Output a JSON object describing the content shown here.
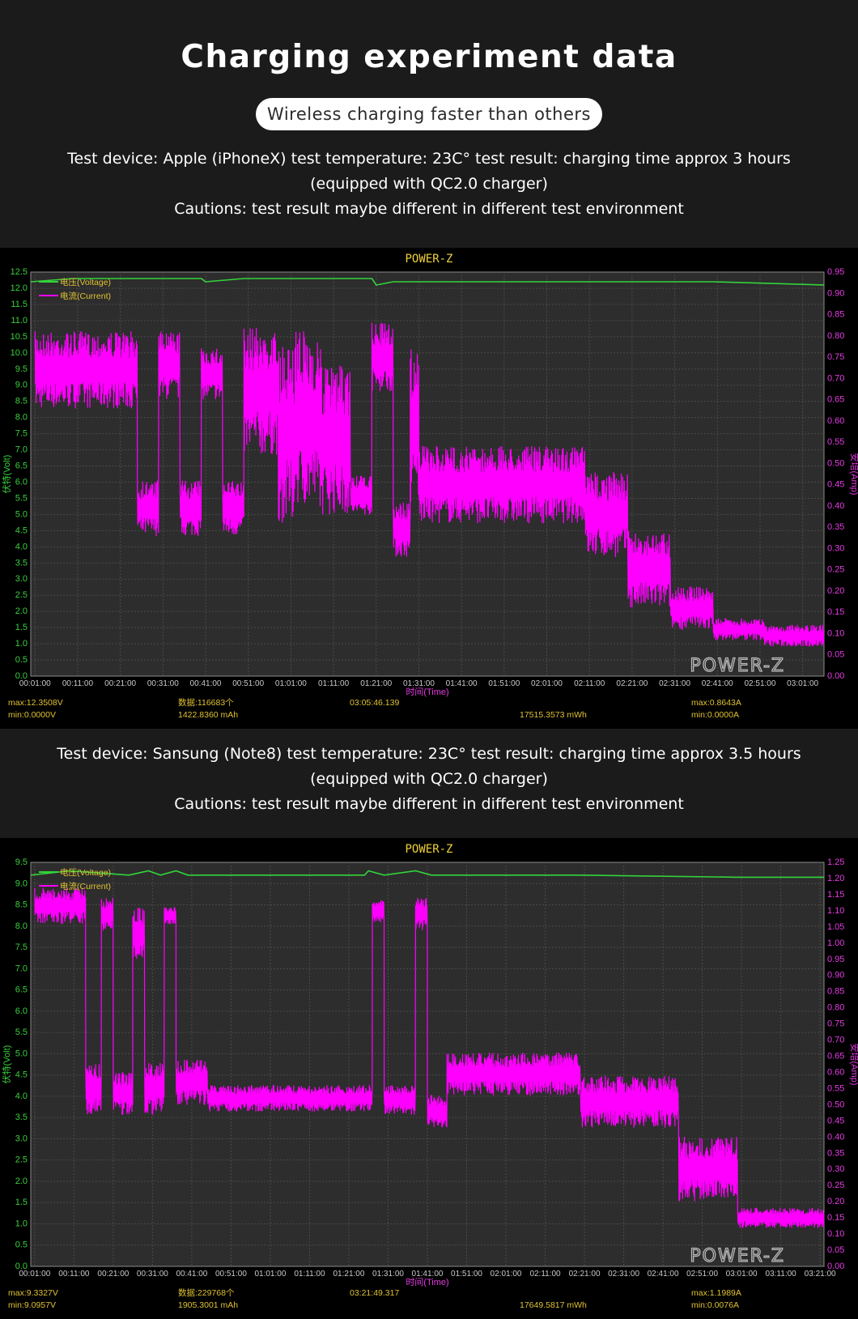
{
  "header": {
    "title": "Charging experiment data",
    "pill": "Wireless charging faster than others",
    "info1": {
      "line1": "Test device: Apple (iPhoneX)  test temperature: 23C° test result: charging time approx 3 hours",
      "line2": "(equipped with QC2.0 charger)",
      "line3": "Cautions: test result maybe different in different test environment"
    },
    "info2": {
      "line1": "Test device: Sansung (Note8)  test temperature: 23C° test result: charging time approx 3.5 hours",
      "line2": "(equipped with QC2.0 charger)",
      "line3": "Cautions: test result maybe different in different test environment"
    }
  },
  "colors": {
    "voltage": "#33d43a",
    "current": "#ff00ff",
    "grid": "#4a4a4a",
    "plot_bg": "#2d2d2d",
    "brand": "#f0d23a"
  },
  "chart_data": [
    {
      "type": "line",
      "title": "POWER-Z",
      "watermark": "POWER-Z",
      "xlabel": "时间(Time)",
      "ylabel_left": "伏特(Volt)",
      "ylabel_right": "安培(Amp)",
      "ylim_left": [
        0,
        12.5
      ],
      "ylim_right": [
        0,
        0.95
      ],
      "left_ticks": [
        "0.0",
        "0.5",
        "1.0",
        "1.5",
        "2.0",
        "2.5",
        "3.0",
        "3.5",
        "4.0",
        "4.5",
        "5.0",
        "5.5",
        "6.0",
        "6.5",
        "7.0",
        "7.5",
        "8.0",
        "8.5",
        "9.0",
        "9.5",
        "10.0",
        "10.5",
        "11.0",
        "11.5",
        "12.0",
        "12.5"
      ],
      "right_ticks": [
        "0.00",
        "0.05",
        "0.10",
        "0.15",
        "0.20",
        "0.25",
        "0.30",
        "0.35",
        "0.40",
        "0.45",
        "0.50",
        "0.55",
        "0.60",
        "0.65",
        "0.70",
        "0.75",
        "0.80",
        "0.85",
        "0.90",
        "0.95"
      ],
      "x_ticks": [
        "00:01:00",
        "00:11:00",
        "00:21:00",
        "00:31:00",
        "00:41:00",
        "00:51:00",
        "01:01:00",
        "01:11:00",
        "01:21:00",
        "01:31:00",
        "01:41:00",
        "01:51:00",
        "02:01:00",
        "02:11:00",
        "02:21:00",
        "02:31:00",
        "02:41:00",
        "02:51:00",
        "03:01:00"
      ],
      "x_minutes_range": [
        0,
        186
      ],
      "legend": [
        "电压(Voltage)",
        "电流(Current)"
      ],
      "series": [
        {
          "name": "电压(Voltage)",
          "axis": "left",
          "color": "#33d43a",
          "points": [
            [
              0,
              12.2
            ],
            [
              10,
              12.3
            ],
            [
              40,
              12.3
            ],
            [
              41,
              12.2
            ],
            [
              50,
              12.3
            ],
            [
              80,
              12.3
            ],
            [
              81,
              12.1
            ],
            [
              85,
              12.2
            ],
            [
              120,
              12.2
            ],
            [
              160,
              12.2
            ],
            [
              186,
              12.1
            ]
          ]
        },
        {
          "name": "电流(Current)",
          "axis": "right",
          "color": "#ff00ff",
          "blocks": [
            [
              1,
              25,
              0.63,
              0.81
            ],
            [
              25,
              30,
              0.33,
              0.46
            ],
            [
              30,
              35,
              0.65,
              0.81
            ],
            [
              35,
              40,
              0.33,
              0.46
            ],
            [
              40,
              45,
              0.65,
              0.77
            ],
            [
              45,
              50,
              0.33,
              0.46
            ],
            [
              50,
              58,
              0.52,
              0.82
            ],
            [
              58,
              62,
              0.36,
              0.79
            ],
            [
              62,
              68,
              0.4,
              0.81
            ],
            [
              68,
              75,
              0.38,
              0.73
            ],
            [
              75,
              80,
              0.38,
              0.47
            ],
            [
              80,
              85,
              0.67,
              0.83
            ],
            [
              85,
              89,
              0.28,
              0.41
            ],
            [
              89,
              91,
              0.4,
              0.78
            ],
            [
              91,
              130,
              0.36,
              0.54
            ],
            [
              130,
              140,
              0.28,
              0.48
            ],
            [
              140,
              150,
              0.16,
              0.34
            ],
            [
              150,
              160,
              0.11,
              0.21
            ],
            [
              160,
              172,
              0.085,
              0.135
            ],
            [
              172,
              186,
              0.07,
              0.12
            ]
          ]
        }
      ],
      "stats": {
        "max_v": "max:12.3508V",
        "min_v": "min:0.0000V",
        "count": "数据:116683个",
        "capacity": "1422.8360 mAh",
        "duration": "03:05:46.139",
        "energy": "17515.3573 mWh",
        "max_a": "max:0.8643A",
        "min_a": "min:0.0000A"
      }
    },
    {
      "type": "line",
      "title": "POWER-Z",
      "watermark": "POWER-Z",
      "xlabel": "时间(Time)",
      "ylabel_left": "伏特(Volt)",
      "ylabel_right": "安培(Amp)",
      "ylim_left": [
        0,
        9.5
      ],
      "ylim_right": [
        0,
        1.25
      ],
      "left_ticks": [
        "0.0",
        "0.5",
        "1.0",
        "1.5",
        "2.0",
        "2.5",
        "3.0",
        "3.5",
        "4.0",
        "4.5",
        "5.0",
        "5.5",
        "6.0",
        "6.5",
        "7.0",
        "7.5",
        "8.0",
        "8.5",
        "9.0",
        "9.5"
      ],
      "right_ticks": [
        "0.00",
        "0.05",
        "0.10",
        "0.15",
        "0.20",
        "0.25",
        "0.30",
        "0.35",
        "0.40",
        "0.45",
        "0.50",
        "0.55",
        "0.60",
        "0.65",
        "0.70",
        "0.75",
        "0.80",
        "0.85",
        "0.90",
        "0.95",
        "1.00",
        "1.05",
        "1.10",
        "1.15",
        "1.20",
        "1.25"
      ],
      "x_ticks": [
        "00:01:00",
        "00:11:00",
        "00:21:00",
        "00:31:00",
        "00:41:00",
        "00:51:00",
        "01:01:00",
        "01:11:00",
        "01:21:00",
        "01:31:00",
        "01:41:00",
        "01:51:00",
        "02:01:00",
        "02:11:00",
        "02:21:00",
        "02:31:00",
        "02:41:00",
        "02:51:00",
        "03:01:00",
        "03:11:00",
        "03:21:00"
      ],
      "x_minutes_range": [
        0,
        202
      ],
      "legend": [
        "电压(Voltage)",
        "电流(Current)"
      ],
      "series": [
        {
          "name": "电压(Voltage)",
          "axis": "left",
          "color": "#33d43a",
          "points": [
            [
              0,
              9.2
            ],
            [
              10,
              9.3
            ],
            [
              25,
              9.2
            ],
            [
              30,
              9.3
            ],
            [
              33,
              9.2
            ],
            [
              37,
              9.3
            ],
            [
              40,
              9.2
            ],
            [
              85,
              9.2
            ],
            [
              86,
              9.3
            ],
            [
              90,
              9.2
            ],
            [
              98,
              9.3
            ],
            [
              102,
              9.2
            ],
            [
              140,
              9.2
            ],
            [
              180,
              9.15
            ],
            [
              202,
              9.15
            ]
          ]
        },
        {
          "name": "电流(Current)",
          "axis": "right",
          "color": "#ff00ff",
          "blocks": [
            [
              1,
              14,
              1.06,
              1.17
            ],
            [
              14,
              18,
              0.47,
              0.63
            ],
            [
              18,
              21,
              1.04,
              1.14
            ],
            [
              21,
              26,
              0.47,
              0.6
            ],
            [
              26,
              29,
              0.95,
              1.11
            ],
            [
              29,
              34,
              0.47,
              0.63
            ],
            [
              34,
              37,
              1.06,
              1.11
            ],
            [
              37,
              45,
              0.5,
              0.64
            ],
            [
              45,
              87,
              0.48,
              0.56
            ],
            [
              87,
              90,
              1.06,
              1.14
            ],
            [
              90,
              98,
              0.47,
              0.56
            ],
            [
              98,
              101,
              1.04,
              1.14
            ],
            [
              101,
              106,
              0.43,
              0.53
            ],
            [
              106,
              140,
              0.53,
              0.66
            ],
            [
              140,
              165,
              0.43,
              0.59
            ],
            [
              165,
              180,
              0.2,
              0.4
            ],
            [
              180,
              202,
              0.12,
              0.18
            ]
          ]
        }
      ],
      "stats": {
        "max_v": "max:9.3327V",
        "min_v": "min:9.0957V",
        "count": "数据:229768个",
        "capacity": "1905.3001 mAh",
        "duration": "03:21:49.317",
        "energy": "17649.5817 mWh",
        "max_a": "max:1.1989A",
        "min_a": "min:0.0076A"
      }
    }
  ]
}
